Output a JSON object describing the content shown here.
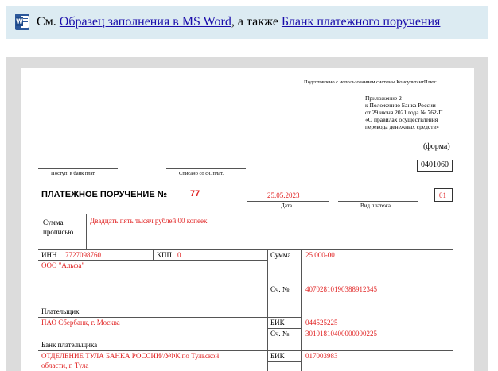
{
  "notice": {
    "prefix": "См. ",
    "link1": "Образец заполнения в MS Word",
    "middle": ", а также ",
    "link2": "Бланк платежного поручения"
  },
  "document": {
    "prepared": "Подготовлено с использованием системы КонсультантПлюс",
    "appendix": [
      "Приложение 2",
      "к Положению Банка России",
      "от 29 июня 2021 года № 762-П",
      "«О правилах осуществления",
      "перевода денежных средств»"
    ],
    "form_label": "(форма)",
    "form_code": "0401060",
    "received_label": "Поступ. в банк плат.",
    "debited_label": "Списано со сч. плат.",
    "title": "ПЛАТЕЖНОЕ ПОРУЧЕНИЕ №",
    "number": "77",
    "date": "25.05.2023",
    "date_label": "Дата",
    "payment_type_label": "Вид платежа",
    "status_code": "01",
    "amount_words_label": "Сумма\nпрописью",
    "amount_words": "Двадцать пять тысяч рублей 00 копеек",
    "inn_label": "ИНН",
    "inn": "7727098760",
    "kpp_label": "КПП",
    "kpp": "0",
    "sum_label": "Сумма",
    "sum": "25 000-00",
    "payer_name": "ООО \"Альфа\"",
    "account_label": "Сч. №",
    "payer_account": "40702810190388912345",
    "payer_label": "Плательщик",
    "payer_bank": "ПАО Сбербанк, г. Москва",
    "bik_label": "БИК",
    "payer_bik": "044525225",
    "payer_bank_account": "30101810400000000225",
    "payer_bank_label": "Банк плательщика",
    "recipient_bank": "ОТДЕЛЕНИЕ ТУЛА БАНКА РОССИИ//УФК по Тульской",
    "recipient_bank_cont": "области, г. Тула",
    "recipient_bik": "017003983"
  },
  "colors": {
    "notice_bg": "#dcebf2",
    "link": "#1a0dab",
    "frame_bg": "#dcdcdc",
    "filled_value": "#e02020"
  }
}
